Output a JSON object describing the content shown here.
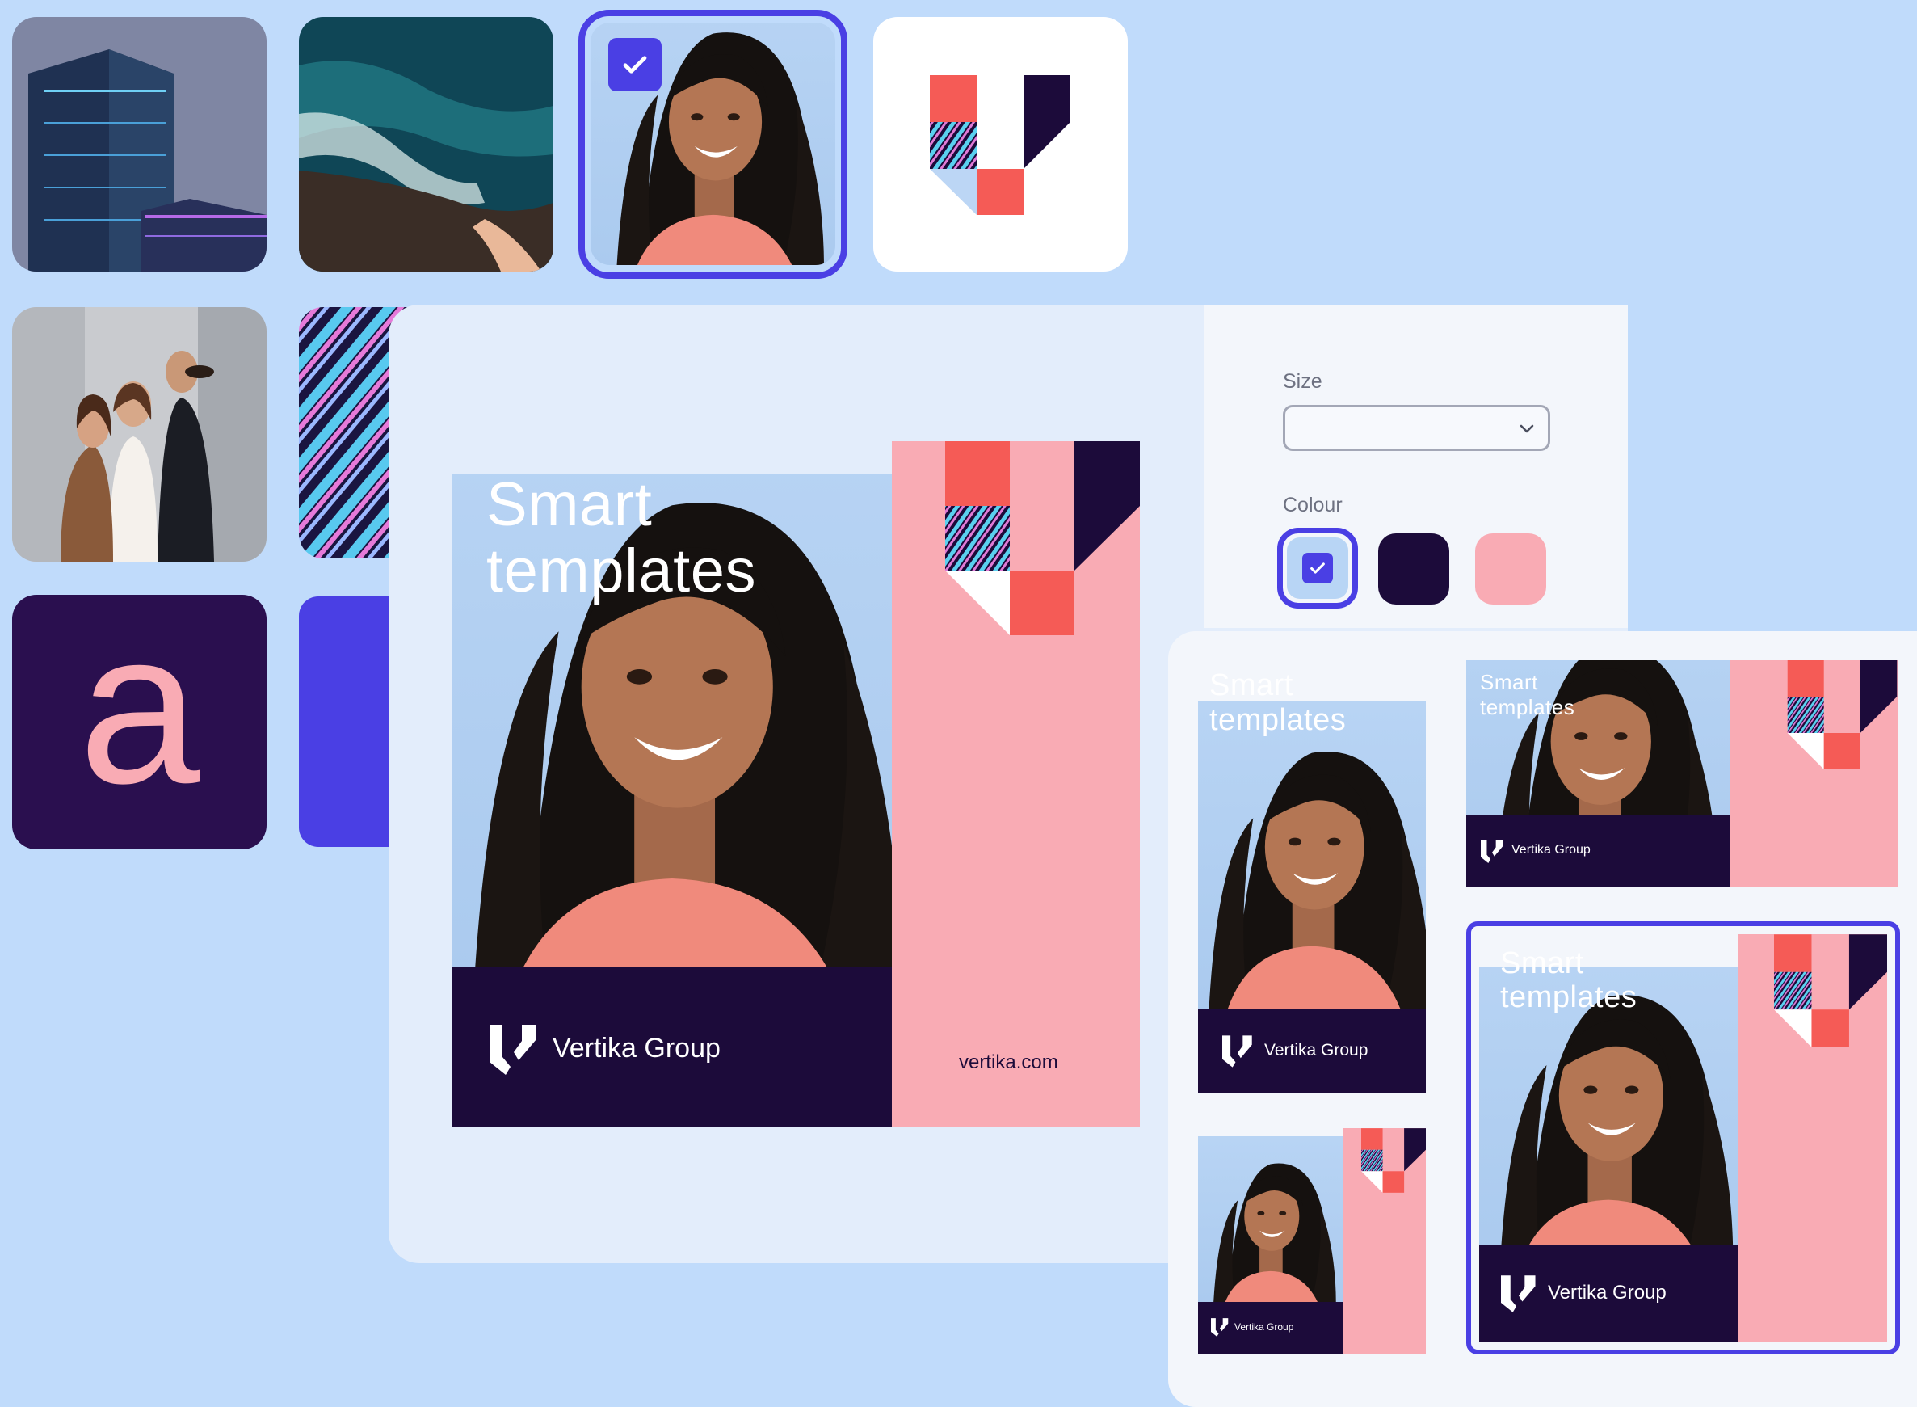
{
  "library": {
    "tiles": [
      {
        "name": "buildings-photo"
      },
      {
        "name": "ocean-aerial-photo"
      },
      {
        "name": "woman-portrait-photo",
        "selected": true
      },
      {
        "name": "vertika-logo-tile"
      },
      {
        "name": "team-photo"
      },
      {
        "name": "ribbons-pattern-photo"
      },
      {
        "name": "font-glyph-tile",
        "glyph": "a"
      },
      {
        "name": "blue-colour-tile"
      }
    ]
  },
  "settings": {
    "size_label": "Size",
    "size_value": "",
    "colour_label": "Colour",
    "colours": [
      {
        "name": "light-blue",
        "hex": "#b8d5f5",
        "selected": true
      },
      {
        "name": "dark-purple",
        "hex": "#1c0b3a",
        "selected": false
      },
      {
        "name": "pink",
        "hex": "#f9abb4",
        "selected": false
      }
    ]
  },
  "template": {
    "headline": "Smart\ntemplates",
    "brand_name": "Vertika Group",
    "url": "vertika.com"
  },
  "variants": [
    {
      "name": "portrait",
      "brand_name": "Vertika Group",
      "headline": "Smart\ntemplates",
      "selected": false
    },
    {
      "name": "landscape",
      "brand_name": "Vertika Group",
      "headline": "Smart\ntemplates",
      "selected": false
    },
    {
      "name": "square-small",
      "brand_name": "Vertika Group",
      "selected": false
    },
    {
      "name": "tall",
      "brand_name": "Vertika Group",
      "headline": "Smart\ntemplates",
      "selected": true
    }
  ],
  "colors": {
    "accent": "#4a3fe4",
    "dark": "#1c0b3a",
    "pink": "#f9abb4",
    "coral": "#f55b56",
    "sky": "#b8d5f5"
  }
}
